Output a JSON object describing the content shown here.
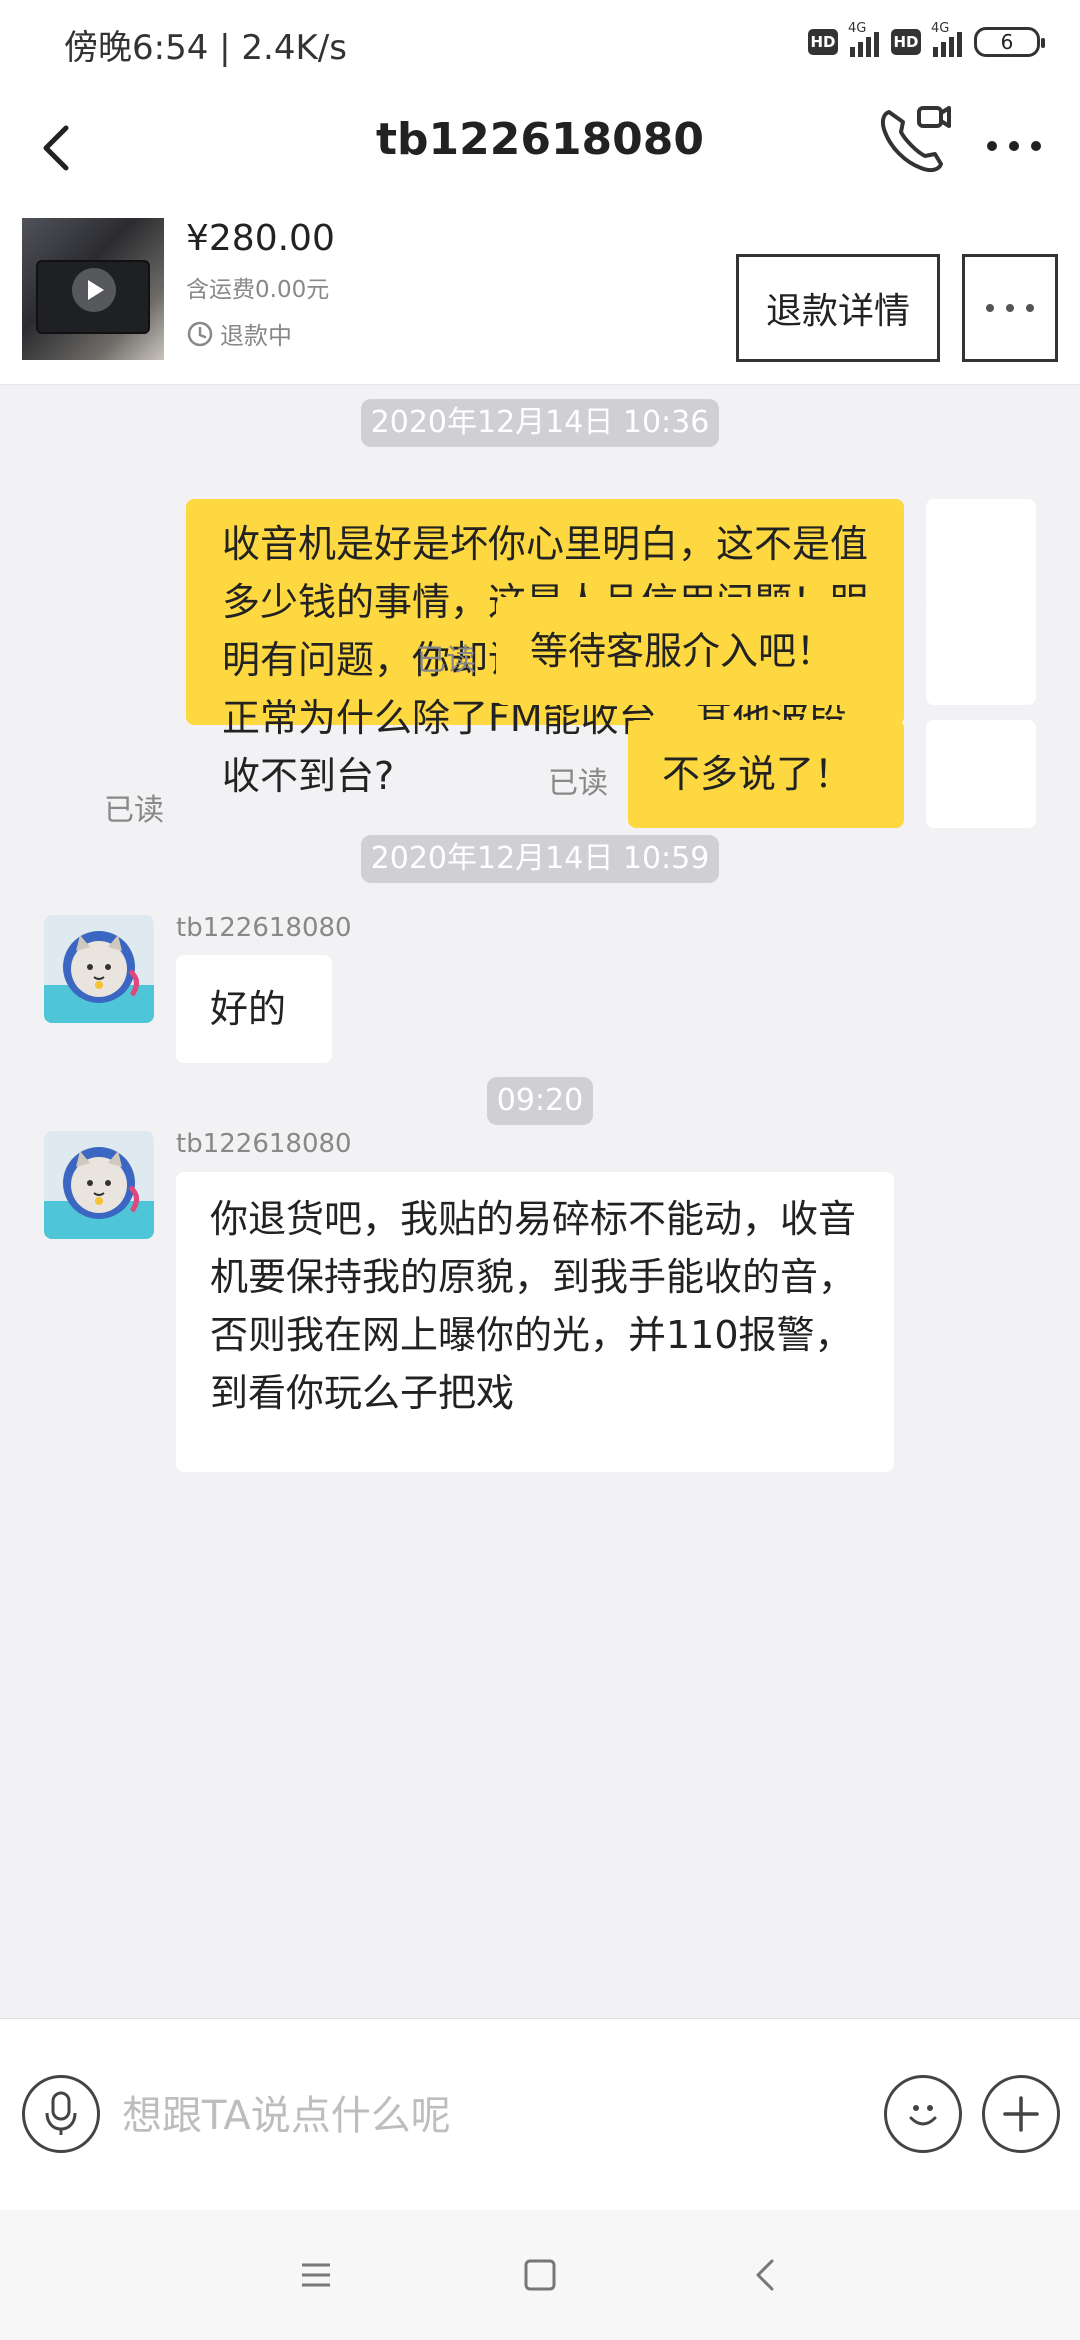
{
  "status_bar": {
    "time": "傍晚6:54 | 2.4K/s",
    "hd1": "HD",
    "net1": "4G",
    "hd2": "HD",
    "net2": "4G",
    "battery": "6"
  },
  "header": {
    "title": "tb122618080"
  },
  "product": {
    "price": "¥280.00",
    "shipping": "含运费0.00元",
    "status": "退款中",
    "refund_detail_label": "退款详情"
  },
  "messages": [
    {
      "kind": "time",
      "text": "2020年12月14日 10:36"
    },
    {
      "kind": "me",
      "text": "收音机是好是坏你心里明白，这不是值多少钱的事情，这是人品信用问题！明明有问题，你却说功能都正常，功能都正常为什么除了FM能收台，其他波段收不到台?",
      "read": "已读"
    },
    {
      "kind": "me",
      "text": "等待客服介入吧！",
      "read": "已读"
    },
    {
      "kind": "me",
      "text": "不多说了！",
      "read": "已读"
    },
    {
      "kind": "time",
      "text": "2020年12月14日 10:59"
    },
    {
      "kind": "other",
      "sender": "tb122618080",
      "text": "好的"
    },
    {
      "kind": "time",
      "text": "09:20"
    },
    {
      "kind": "other",
      "sender": "tb122618080",
      "text": "你退货吧，我贴的易碎标不能动，收音机要保持我的原貌，到我手能收的音，否则我在网上曝你的光，并110报警，到看你玩么子把戏"
    }
  ],
  "input": {
    "placeholder": "想跟TA说点什么呢"
  },
  "colors": {
    "my_bubble": "#fdd841",
    "chat_bg": "#f2f2f5",
    "time_chip": "#cfcfd4"
  }
}
